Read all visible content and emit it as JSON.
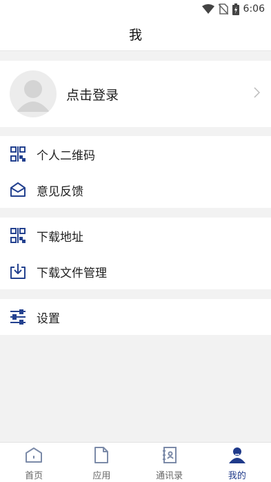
{
  "status_bar": {
    "time": "6:06",
    "icons": [
      "wifi-icon",
      "no-sim-icon",
      "battery-charging-icon"
    ]
  },
  "header": {
    "title": "我"
  },
  "profile": {
    "login_label": "点击登录",
    "avatar_icon": "default-avatar-icon",
    "chevron_icon": "chevron-right-icon"
  },
  "groups": [
    {
      "items": [
        {
          "label": "个人二维码",
          "icon": "qr-code-icon"
        },
        {
          "label": "意见反馈",
          "icon": "envelope-open-icon"
        }
      ]
    },
    {
      "items": [
        {
          "label": "下载地址",
          "icon": "qr-code-icon"
        },
        {
          "label": "下载文件管理",
          "icon": "download-tray-icon"
        }
      ]
    },
    {
      "items": [
        {
          "label": "设置",
          "icon": "sliders-icon"
        }
      ]
    }
  ],
  "tabs": [
    {
      "label": "首页",
      "icon": "home-icon",
      "active": false
    },
    {
      "label": "应用",
      "icon": "document-icon",
      "active": false
    },
    {
      "label": "通讯录",
      "icon": "contacts-book-icon",
      "active": false
    },
    {
      "label": "我的",
      "icon": "person-icon",
      "active": true
    }
  ],
  "colors": {
    "accent": "#1f3a8a",
    "icon_blue": "#23418f",
    "background": "#f2f2f2",
    "surface": "#ffffff"
  }
}
